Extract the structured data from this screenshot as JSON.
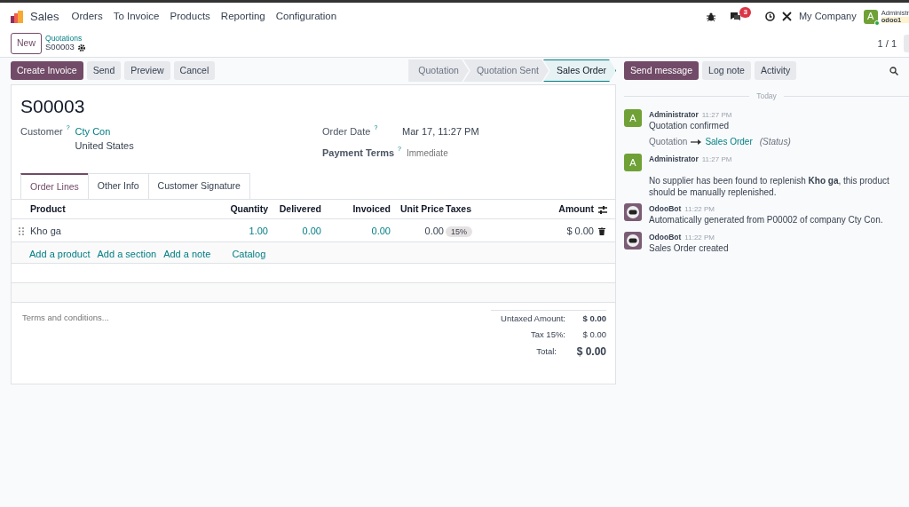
{
  "navbar": {
    "app_name": "Sales",
    "menus": [
      "Orders",
      "To Invoice",
      "Products",
      "Reporting",
      "Configuration"
    ],
    "messages_count": "3",
    "company": "My Company",
    "avatar_letter": "A",
    "user": "Administr",
    "database": "odoo1"
  },
  "control_panel": {
    "new_button": "New",
    "breadcrumb_parent": "Quotations",
    "breadcrumb_current": "S00003",
    "pager": "1 / 1"
  },
  "actions": [
    {
      "label": "Create Invoice",
      "primary": true
    },
    {
      "label": "Send",
      "primary": false
    },
    {
      "label": "Preview",
      "primary": false
    },
    {
      "label": "Cancel",
      "primary": false
    }
  ],
  "statusbar": [
    {
      "label": "Quotation",
      "selected": false
    },
    {
      "label": "Quotation Sent",
      "selected": false
    },
    {
      "label": "Sales Order",
      "selected": true
    }
  ],
  "chatter_buttons": [
    {
      "label": "Send message",
      "primary": true
    },
    {
      "label": "Log note",
      "primary": false
    },
    {
      "label": "Activity",
      "primary": false
    }
  ],
  "form": {
    "title": "S00003",
    "customer": {
      "label": "Customer",
      "help": "?",
      "value": "Cty Con",
      "address": "United States"
    },
    "order_date": {
      "label": "Order Date",
      "help": "?",
      "value": "Mar 17, 11:27 PM"
    },
    "payment_terms": {
      "label": "Payment Terms",
      "help": "?",
      "placeholder": "Immediate"
    },
    "tabs": [
      {
        "label": "Order Lines",
        "selected": true
      },
      {
        "label": "Other Info",
        "selected": false
      },
      {
        "label": "Customer Signature",
        "selected": false
      }
    ],
    "table": {
      "columns": [
        "Product",
        "Quantity",
        "Delivered",
        "Invoiced",
        "Unit Price",
        "Taxes",
        "Amount"
      ],
      "rows": [
        {
          "product": "Kho ga",
          "quantity": "1.00",
          "delivered": "0.00",
          "invoiced": "0.00",
          "unit_price": "0.00",
          "taxes": [
            "15%"
          ],
          "amount": "$ 0.00"
        }
      ]
    },
    "add_links": [
      "Add a product",
      "Add a section",
      "Add a note",
      "Catalog"
    ],
    "terms_placeholder": "Terms and conditions...",
    "totals": [
      {
        "label": "Untaxed Amount:",
        "value": "$ 0.00",
        "kind": "strong"
      },
      {
        "label": "Tax 15%:",
        "value": "$ 0.00",
        "kind": "normal"
      },
      {
        "label": "Total:",
        "value": "$ 0.00",
        "kind": "total"
      }
    ]
  },
  "chatter": {
    "date_separator": "Today",
    "messages": [
      {
        "author": "Administrator",
        "time": "11:27 PM",
        "kind": "letter",
        "avatar_letter": "A",
        "body": "Quotation confirmed",
        "tracking": {
          "old": "Quotation",
          "new": "Sales Order",
          "field": "(Status)"
        }
      },
      {
        "author": "Administrator",
        "time": "11:27 PM",
        "kind": "letter",
        "avatar_letter": "A",
        "body": "No supplier has been found to replenish **Kho ga**, this product should be manually replenished.",
        "spaced": true
      },
      {
        "author": "OdooBot",
        "time": "11:22 PM",
        "kind": "bot",
        "body": "Automatically generated from P00002 of company Cty Con."
      },
      {
        "author": "OdooBot",
        "time": "11:22 PM",
        "kind": "bot",
        "body": "Sales Order created"
      }
    ]
  }
}
